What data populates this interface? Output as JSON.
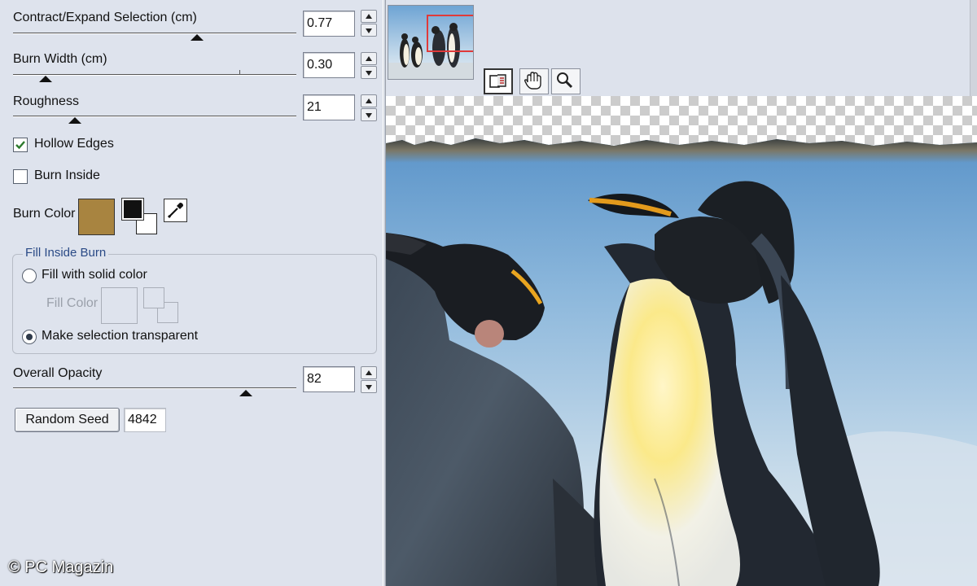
{
  "panel": {
    "contract": {
      "label": "Contract/Expand Selection (cm)",
      "value": "0.77",
      "level": 0.66
    },
    "burn_width": {
      "label": "Burn Width (cm)",
      "value": "0.30",
      "level": 0.1
    },
    "roughness": {
      "label": "Roughness",
      "value": "21",
      "level": 0.21
    },
    "hollow_edges": {
      "label": "Hollow Edges",
      "checked": true
    },
    "burn_inside": {
      "label": "Burn Inside",
      "checked": false
    },
    "burn_color": {
      "label": "Burn Color",
      "color": "#a88440"
    },
    "fill_group": {
      "title": "Fill Inside Burn",
      "fill_solid": {
        "label": "Fill with solid color",
        "selected": false
      },
      "fill_color_label": "Fill Color",
      "make_transparent": {
        "label": "Make selection transparent",
        "selected": true
      }
    },
    "opacity": {
      "label": "Overall Opacity",
      "value": "82",
      "level": 0.82
    },
    "random_seed": {
      "button_label": "Random Seed",
      "value": "4842"
    }
  },
  "toolbar": {
    "tools": [
      "selection-tool-icon",
      "hand-tool-icon",
      "zoom-tool-icon"
    ]
  },
  "watermark": "© PC Magazin"
}
